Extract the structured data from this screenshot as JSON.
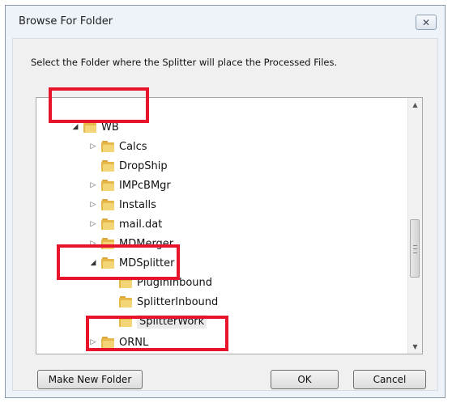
{
  "dialog": {
    "title": "Browse For Folder",
    "close_glyph": "✕",
    "instruction": "Select the Folder where the Splitter will place the Processed Files."
  },
  "tree": {
    "items": [
      {
        "label": "WB",
        "expander": "◢"
      },
      {
        "label": "Calcs",
        "expander": "▷"
      },
      {
        "label": "DropShip",
        "expander": ""
      },
      {
        "label": "IMPcBMgr",
        "expander": "▷"
      },
      {
        "label": "Installs",
        "expander": "▷"
      },
      {
        "label": "mail.dat",
        "expander": "▷"
      },
      {
        "label": "MDMerger",
        "expander": "▷"
      },
      {
        "label": "MDSplitter",
        "expander": "◢"
      },
      {
        "label": "PlugInInbound",
        "expander": ""
      },
      {
        "label": "SplitterInbound",
        "expander": ""
      },
      {
        "label": "SplitterWork",
        "expander": "",
        "selected": true
      },
      {
        "label": "ORNL",
        "expander": "▷"
      }
    ]
  },
  "scrollbar": {
    "up_glyph": "▲",
    "down_glyph": "▼"
  },
  "buttons": {
    "make_new_folder": "Make New Folder",
    "ok": "OK",
    "cancel": "Cancel"
  },
  "colors": {
    "highlight": "#e8142b",
    "folder": "#e6b84a"
  }
}
